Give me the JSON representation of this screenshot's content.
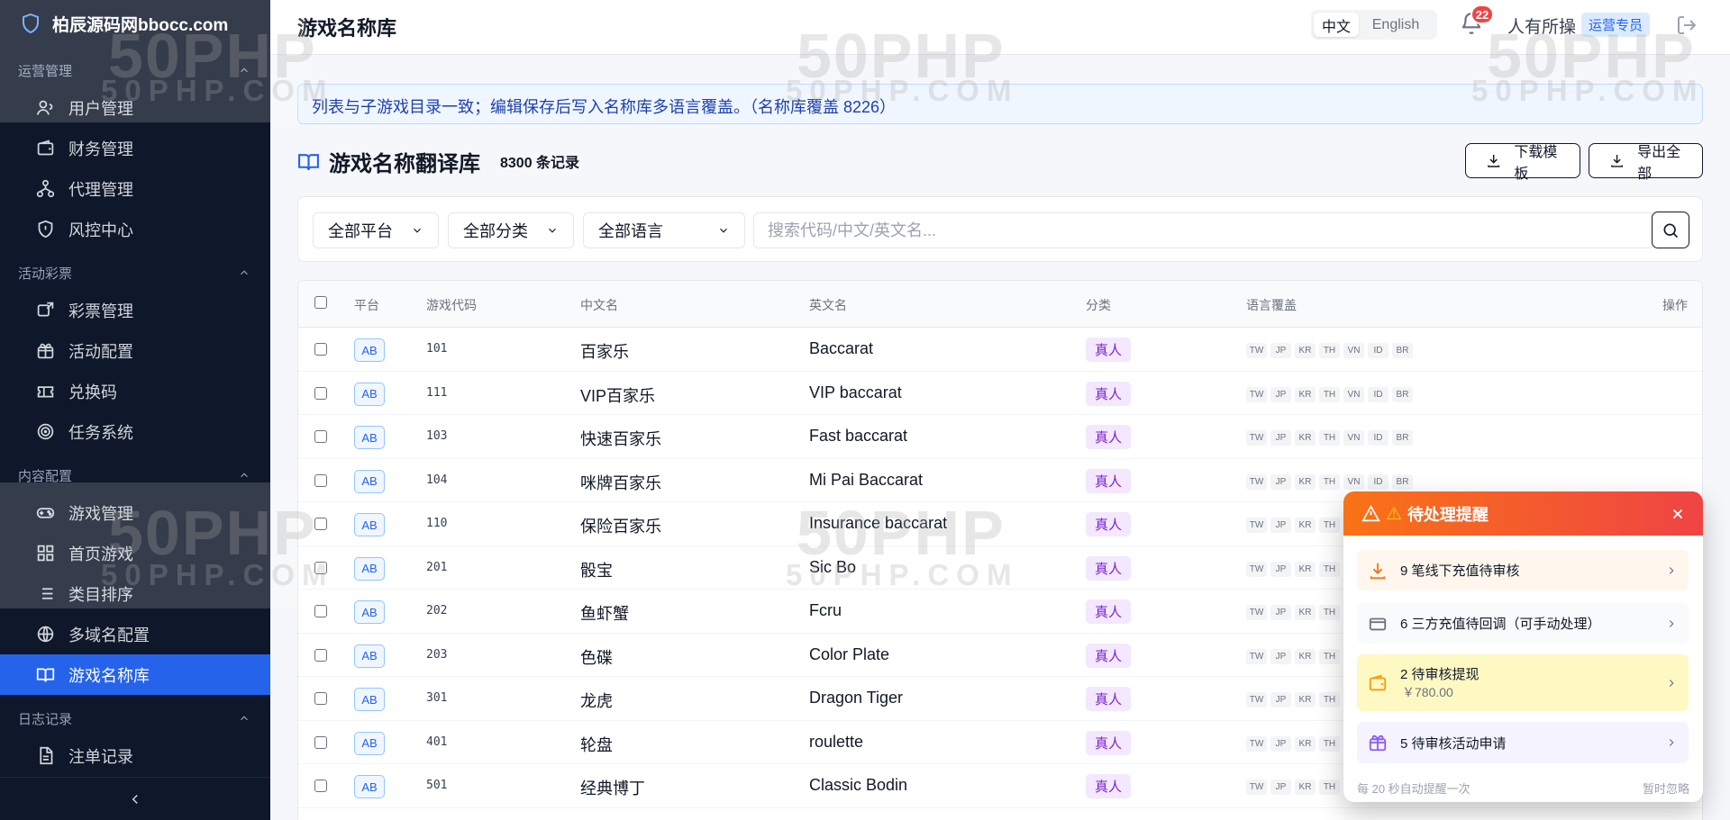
{
  "brand": {
    "name": "柏辰源码网bbocc.com"
  },
  "sidebar": {
    "groups": [
      {
        "title": "运营管理",
        "items": [
          "用户管理",
          "财务管理",
          "代理管理",
          "风控中心"
        ]
      },
      {
        "title": "活动彩票",
        "items": [
          "彩票管理",
          "活动配置",
          "兑换码",
          "任务系统"
        ]
      },
      {
        "title": "内容配置",
        "items": [
          "游戏管理",
          "首页游戏",
          "类目排序",
          "多域名配置",
          "游戏名称库"
        ]
      },
      {
        "title": "日志记录",
        "items": [
          "注单记录"
        ]
      }
    ],
    "active_item": "游戏名称库"
  },
  "topbar": {
    "title": "游戏名称库",
    "lang_cn": "中文",
    "lang_en": "English",
    "notification_count": "22",
    "username": "人有所操",
    "role": "运营专员"
  },
  "notice": "列表与子游戏目录一致；编辑保存后写入名称库多语言覆盖。（名称库覆盖 8226）",
  "section": {
    "title": "游戏名称翻译库",
    "record_count": "8300 条记录",
    "download_template": "下载模板",
    "export_all": "导出全部"
  },
  "filters": {
    "platform": "全部平台",
    "category": "全部分类",
    "language": "全部语言",
    "search_placeholder": "搜索代码/中文/英文名..."
  },
  "table": {
    "headers": [
      "平台",
      "游戏代码",
      "中文名",
      "英文名",
      "分类",
      "语言覆盖",
      "操作"
    ],
    "languages": [
      "TW",
      "JP",
      "KR",
      "TH",
      "VN",
      "ID",
      "BR"
    ],
    "rows": [
      {
        "platform": "AB",
        "code": "101",
        "cn": "百家乐",
        "en": "Baccarat",
        "category": "真人",
        "show_all_langs": true
      },
      {
        "platform": "AB",
        "code": "111",
        "cn": "VIP百家乐",
        "en": "VIP baccarat",
        "category": "真人",
        "show_all_langs": true
      },
      {
        "platform": "AB",
        "code": "103",
        "cn": "快速百家乐",
        "en": "Fast baccarat",
        "category": "真人",
        "show_all_langs": true
      },
      {
        "platform": "AB",
        "code": "104",
        "cn": "咪牌百家乐",
        "en": "Mi Pai Baccarat",
        "category": "真人",
        "show_all_langs": true
      },
      {
        "platform": "AB",
        "code": "110",
        "cn": "保险百家乐",
        "en": "Insurance baccarat",
        "category": "真人",
        "show_all_langs": false
      },
      {
        "platform": "AB",
        "code": "201",
        "cn": "骰宝",
        "en": "Sic Bo",
        "category": "真人",
        "show_all_langs": false
      },
      {
        "platform": "AB",
        "code": "202",
        "cn": "鱼虾蟹",
        "en": "Fcru",
        "category": "真人",
        "show_all_langs": false
      },
      {
        "platform": "AB",
        "code": "203",
        "cn": "色碟",
        "en": "Color Plate",
        "category": "真人",
        "show_all_langs": false
      },
      {
        "platform": "AB",
        "code": "301",
        "cn": "龙虎",
        "en": "Dragon Tiger",
        "category": "真人",
        "show_all_langs": false
      },
      {
        "platform": "AB",
        "code": "401",
        "cn": "轮盘",
        "en": "roulette",
        "category": "真人",
        "show_all_langs": false
      },
      {
        "platform": "AB",
        "code": "501",
        "cn": "经典博丁",
        "en": "Classic Bodin",
        "category": "真人",
        "show_all_langs": false
      }
    ]
  },
  "popup": {
    "title": "待处理提醒",
    "items": [
      {
        "text": "9 笔线下充值待审核",
        "sub": "",
        "color": "#fff7ed",
        "icon": "download-icon"
      },
      {
        "text": "6 三方充值待回调（可手动处理）",
        "sub": "",
        "color": "#f8fafc",
        "icon": "card-icon"
      },
      {
        "text": "2 待审核提现",
        "sub": "￥780.00",
        "color": "#fef9c3",
        "icon": "wallet-icon"
      },
      {
        "text": "5 待审核活动申请",
        "sub": "",
        "color": "#f5f3ff",
        "icon": "gift-icon"
      }
    ],
    "footer_left": "每 20 秒自动提醒一次",
    "footer_right": "暂时忽略"
  },
  "watermark": {
    "primary": "50PHP",
    "secondary": "50PHP.COM"
  }
}
